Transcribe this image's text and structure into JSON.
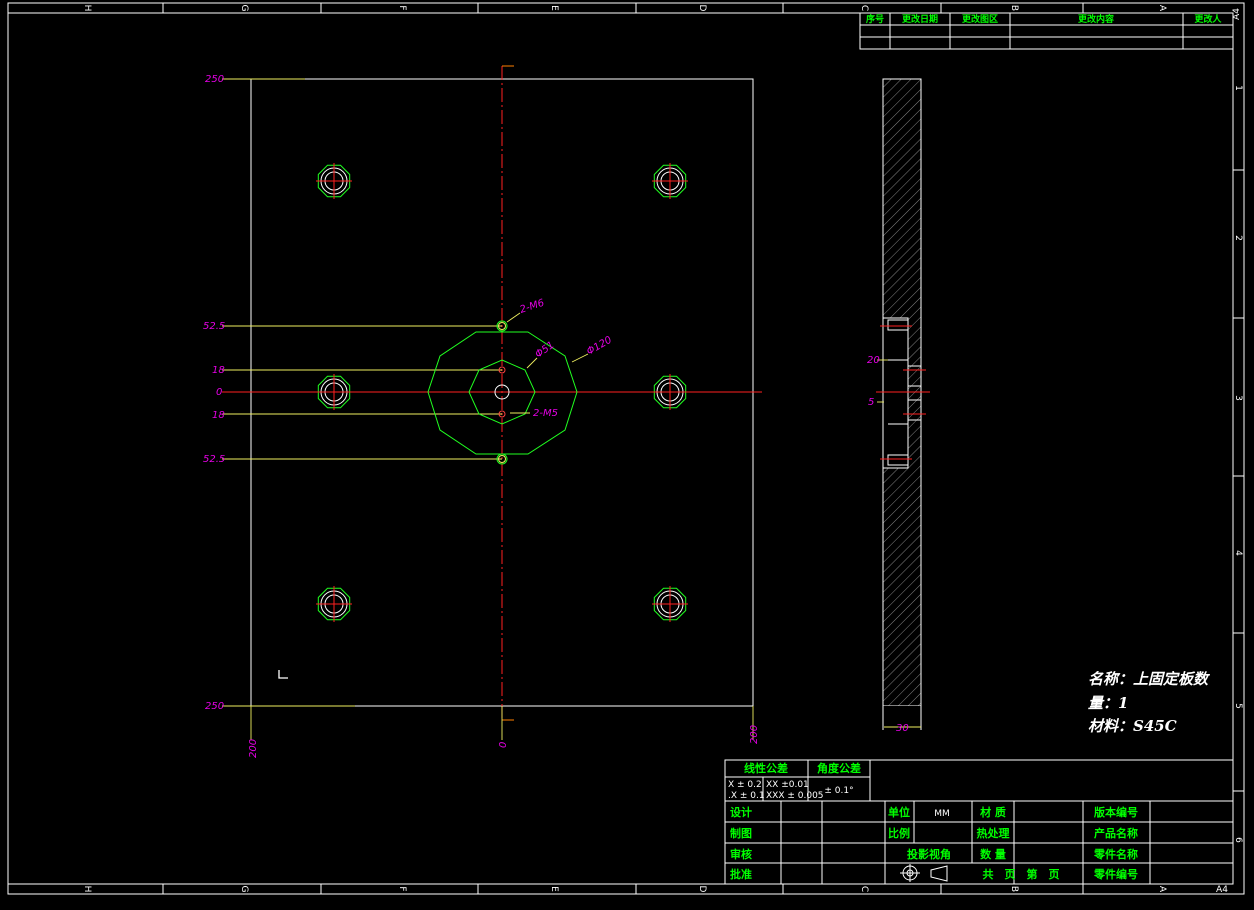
{
  "border": {
    "columns": [
      "H",
      "G",
      "F",
      "E",
      "D",
      "C",
      "B",
      "A"
    ],
    "rows": [
      "1",
      "2",
      "3",
      "4",
      "5",
      "6"
    ],
    "sheet_size": "A4"
  },
  "revision_table": {
    "headers": [
      "序号",
      "更改日期",
      "更改图区",
      "更改内容",
      "更改人"
    ]
  },
  "front_view": {
    "dims_left": [
      "250",
      "52.5",
      "18",
      "0",
      "18",
      "52.5",
      "250"
    ],
    "dims_bottom": [
      "200",
      "0",
      "200"
    ],
    "callouts": [
      "2-M6",
      "Φ51",
      "Φ120",
      "2-M5"
    ]
  },
  "side_view": {
    "dims": [
      "20",
      "5",
      "30"
    ]
  },
  "part_info": {
    "name": "名称：上固定板数",
    "qty": "量：1",
    "material": "材料：S45C"
  },
  "title_block": {
    "linear_tol_label": "线性公差",
    "angle_tol_label": "角度公差",
    "tol_x": "X ± 0.2",
    "tol_xx": "XX ±0.01",
    "tol_dotx": ".X ± 0.1",
    "tol_xxx": "XXX ± 0.005",
    "angle_tol": "± 0.1°",
    "design": "设计",
    "draw": "制图",
    "review": "审核",
    "approve": "批准",
    "unit": "单位",
    "unit_val": "MM",
    "ratio": "比例",
    "projection": "投影视角",
    "material": "材 质",
    "heat": "热处理",
    "quantity": "数 量",
    "pages": "共　页　第　页",
    "version": "版本编号",
    "product": "产品名称",
    "part_name": "零件名称",
    "part_no": "零件编号"
  }
}
